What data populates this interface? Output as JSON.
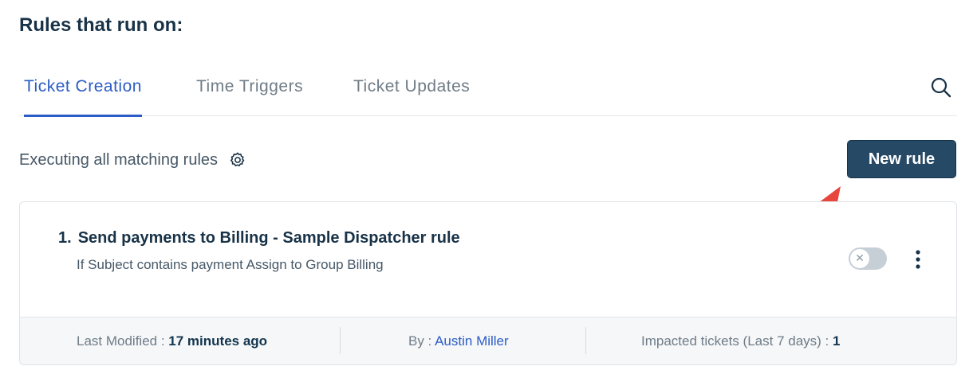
{
  "page": {
    "heading": "Rules that run on:"
  },
  "tabs": [
    {
      "label": "Ticket Creation",
      "active": true
    },
    {
      "label": "Time Triggers",
      "active": false
    },
    {
      "label": "Ticket Updates",
      "active": false
    }
  ],
  "toolbar": {
    "search_icon": "search-icon",
    "executing_label": "Executing all matching rules",
    "settings_icon": "gear-icon",
    "new_rule_label": "New rule"
  },
  "rules": [
    {
      "index": "1.",
      "title": "Send payments to Billing - Sample Dispatcher rule",
      "description": "If Subject contains payment Assign to Group Billing",
      "enabled": false,
      "footer": {
        "modified_label": "Last Modified :",
        "modified_value": "17 minutes ago",
        "by_label": "By :",
        "by_value": "Austin Miller",
        "impacted_label": "Impacted tickets (Last 7 days) :",
        "impacted_value": "1"
      }
    }
  ],
  "colors": {
    "accent": "#2c5cc5",
    "primary_button": "#264966",
    "annotation_arrow": "#e8453c"
  }
}
